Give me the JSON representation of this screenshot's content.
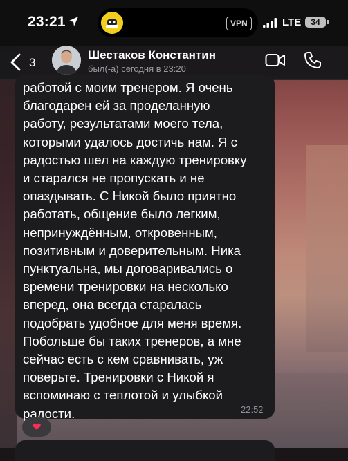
{
  "status_bar": {
    "time": "23:21",
    "vpn": "VPN",
    "network": "LTE",
    "battery": "34"
  },
  "header": {
    "back_count": "3",
    "contact_name": "Шестаков Константин",
    "last_seen": "был(-а) сегодня в 23:20"
  },
  "message": {
    "text": "работой с моим тренером. Я очень\nблагодарен ей за проделанную\nработу, результатами моего тела,\nкоторыми  удалось достичь нам. Я с\nрадостью шел на каждую тренировку\nи старался не пропускать и не\nопаздывать. С Никой было приятно\nработать, общение было легким,\nнепринуждённым, откровенным,\nпозитивным и доверительным. Ника\nпунктуальна,  мы договаривались о\nвремени тренировки на несколько\nвперед, она всегда старалась\nподобрать удобное для меня время.\nПобольше бы таких тренеров, а мне\nсейчас есть с кем сравнивать, уж\nповерьте. Тренировки с Никой я\nвспоминаю с теплотой и улыбкой\nрадости.",
    "time": "22:52",
    "reaction": "❤"
  }
}
